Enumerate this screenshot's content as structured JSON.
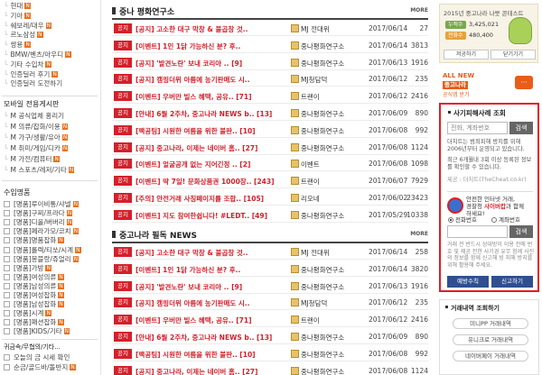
{
  "sidebar": {
    "brands": [
      {
        "label": "현대",
        "badge": "N"
      },
      {
        "label": "기아",
        "badge": "N"
      },
      {
        "label": "쉐보레/대우",
        "badge": "N"
      },
      {
        "label": "르노삼성",
        "badge": "N"
      },
      {
        "label": "쌍용",
        "badge": "N"
      },
      {
        "label": "BMW/벤츠/아우디",
        "badge": "N"
      },
      {
        "label": "기타 수입차",
        "badge": "N"
      },
      {
        "label": "인증딜러 후기",
        "badge": "N"
      },
      {
        "label": "인증딜러 도전하기",
        "badge": ""
      }
    ],
    "mobile_title": "모바일 전용게시판",
    "mobile_items": [
      {
        "label": "M 공식업체 홍리기"
      },
      {
        "label": "M 의류/잡화/이용",
        "badge": "N"
      },
      {
        "label": "M 가구/생활/유아",
        "badge": "N"
      },
      {
        "label": "M 취미/게임/디카",
        "badge": "N"
      },
      {
        "label": "M 가전/컴퓨터",
        "badge": "N"
      },
      {
        "label": "M 스포츠/레저/기타",
        "badge": "N"
      }
    ],
    "import_title": "수입명품",
    "import_items": [
      {
        "label": "[명품]루이비통/샤넬",
        "badge": "N"
      },
      {
        "label": "[명품]구찌/프라다",
        "badge": "N"
      },
      {
        "label": "[명품]디올/버버리",
        "badge": "N"
      },
      {
        "label": "[명품]페라가모/코치",
        "badge": "N"
      },
      {
        "label": "[명품]명품잡화",
        "badge": "N"
      },
      {
        "label": "[명품]롤렉/티쏘/시계",
        "badge": "N"
      },
      {
        "label": "[명품]몽블랑/쥬얼리",
        "badge": "N"
      },
      {
        "label": "[명품]가방",
        "badge": "N"
      },
      {
        "label": "[명품]여성의류",
        "badge": "N"
      },
      {
        "label": "[명품]남성의류",
        "badge": "N"
      },
      {
        "label": "[명품]여성잡화",
        "badge": "N"
      },
      {
        "label": "[명품]남성잡화",
        "badge": "N"
      },
      {
        "label": "[명품]시계",
        "badge": "N"
      },
      {
        "label": "[명품]패션잡화",
        "badge": "N"
      },
      {
        "label": "[명품]KIDS/기타",
        "badge": "N"
      }
    ],
    "bottom_title": "귀금속/무협의/기타...",
    "bottom_items": [
      {
        "label": "오늘의 금 시세 확인",
        "badge": ""
      },
      {
        "label": "순금/골드바/돌반지",
        "badge": "N"
      }
    ]
  },
  "main": {
    "more_label": "MORE",
    "sections": [
      {
        "title": "중나 평화연구소",
        "rows": [
          {
            "tag": "공지",
            "title": "[공지] 고소한 대구 막창 & 불곱창 것..",
            "writer": "MJ 전대위",
            "date": "2017/06/14",
            "views": "27"
          },
          {
            "tag": "공지",
            "title": "[이벤트] 1인 1닭 가능하신 분? 후..",
            "writer": "중나평화연구소",
            "date": "2017/06/14",
            "views": "3813"
          },
          {
            "tag": "공지",
            "title": "[공지] '발견노란' 보내 코리아 .. [9]",
            "writer": "중나평화연구소",
            "date": "2017/06/13",
            "views": "1916"
          },
          {
            "tag": "공지",
            "title": "[공지] 캠핑더위 아름에 농기판매도 시..",
            "writer": "MJ청담덕",
            "date": "2017/06/12",
            "views": "235"
          },
          {
            "tag": "공지",
            "title": "[이벤트] 우버만 빌스 혜택, 공유.. [71]",
            "writer": "트랜이",
            "date": "2017/06/12",
            "views": "2416"
          },
          {
            "tag": "공지",
            "title": "[안내] 6월 2주차, 중고나라 NEWS b.. [13]",
            "writer": "중나평화연구소",
            "date": "2017/06/09",
            "views": "890"
          },
          {
            "tag": "공지",
            "title": "[팩공팀] 시원한 여름을 위한 불판.. [10]",
            "writer": "중나평화연구소",
            "date": "2017/06/08",
            "views": "992"
          },
          {
            "tag": "공지",
            "title": "[공지] 중고나라, 이제는 네이버 홈.. [27]",
            "writer": "중나평화연구소",
            "date": "2017/06/08",
            "views": "1124"
          },
          {
            "tag": "공지",
            "title": "[이벤트] 얼굴공개 없는 지어긴정 .. [2]",
            "writer": "이벤트",
            "date": "2017/06/08",
            "views": "1098"
          },
          {
            "tag": "공지",
            "title": "[이벤트] 딱 7일! 문화상품권 1000장.. [243]",
            "writer": "트랜이",
            "date": "2017/06/07",
            "views": "7929"
          },
          {
            "tag": "공지",
            "title": "[주의] 안전거래 사칭페이지를 조합.. [105]",
            "writer": "리오네",
            "date": "2017/06/02",
            "views": "23423"
          },
          {
            "tag": "공지",
            "title": "[이벤트] 지도 참여한쉽니다! #LEDT.. [49]",
            "writer": "중나평화연구소",
            "date": "2017/05/29",
            "views": "10338"
          }
        ]
      },
      {
        "title": "중고나라 필독 NEWS",
        "rows": [
          {
            "tag": "공지",
            "title": "[공지] 고소한 대구 막창 & 불곱창 것..",
            "writer": "MJ 전대위",
            "date": "2017/06/14",
            "views": "258"
          },
          {
            "tag": "공지",
            "title": "[이벤트] 1인 1닭 가능하신 분? 후..",
            "writer": "중나평화연구소",
            "date": "2017/06/14",
            "views": "3820"
          },
          {
            "tag": "공지",
            "title": "[공지] '발견노란' 보내 코리아 .. [9]",
            "writer": "중나평화연구소",
            "date": "2017/06/13",
            "views": "1916"
          },
          {
            "tag": "공지",
            "title": "[공지] 캠핑더위 아름에 농기판매도 시..",
            "writer": "MJ청담덕",
            "date": "2017/06/12",
            "views": "235"
          },
          {
            "tag": "공지",
            "title": "[이벤트] 우버만 빌스 혜택, 공유.. [71]",
            "writer": "트랜이",
            "date": "2017/06/12",
            "views": "2416"
          },
          {
            "tag": "공지",
            "title": "[안내] 6월 2주차, 중고나라 NEWS b.. [13]",
            "writer": "중나평화연구소",
            "date": "2017/06/09",
            "views": "890"
          },
          {
            "tag": "공지",
            "title": "[팩공팀] 시원한 여름을 위한 불판.. [10]",
            "writer": "중나평화연구소",
            "date": "2017/06/08",
            "views": "992"
          },
          {
            "tag": "공지",
            "title": "[공지] 중고나라, 이제는 네이버 홈.. [27]",
            "writer": "중나평화연구소",
            "date": "2017/06/08",
            "views": "1124"
          }
        ]
      }
    ]
  },
  "right": {
    "promo": {
      "text": "2015년 중고나라 나뭇 콘테스트",
      "row1_pill": "누적수",
      "row1_value": "3,425,021",
      "row2_pill": "전화수",
      "row2_value": "480,400",
      "btn_left": "저공하기",
      "btn_right": "닫기기기"
    },
    "banner": {
      "line1": "ALL NEW",
      "line2": "중고나라",
      "line3": "공식앱 받기",
      "icon": "chat-icon"
    },
    "fraud": {
      "title": "사기피해사례 조회",
      "input_placeholder": "전화, 계좌번호",
      "search_label": "검색",
      "desc1": "더치트는 범죄피해 방지를 위해 2006년부터 운영되고 있습니다.",
      "desc2": "최근 6개월내 3회 이상 등록된 정보를 확인할 수 있습니다.",
      "source": "제공 : 더치트(TheCheat.co.kr)",
      "banner_line1": "안전한 인터넷 거래,",
      "banner_line2a": "경찰청 ",
      "banner_line2b": "사이버캅",
      "banner_line2c": "과 함께",
      "banner_line3": "하세요!",
      "radio_phone": "전화번호",
      "radio_account": "계좌번호",
      "search2_label": "검색",
      "desc3": "거래 전 반드시 상대방이 이용 전에 번호 및 제공 전한 사기경 유무 함께 사진의 정보를 함께 신고해 빙 피해 방지를 위해 활용해 주세요.",
      "btn_report": "예방수칙",
      "btn_howto": "신고하기"
    },
    "history": {
      "title": "거래내역 조회하기",
      "btn1": "미니PP 거래내역",
      "btn2": "유니크로 거래내역",
      "btn3": "네이버페이 거래내역"
    }
  },
  "colors": {
    "notice_red": "#d4202a",
    "fraud_border": "#e31b23",
    "accent_orange": "#e85d1a",
    "button_blue": "#2f4f8f"
  }
}
